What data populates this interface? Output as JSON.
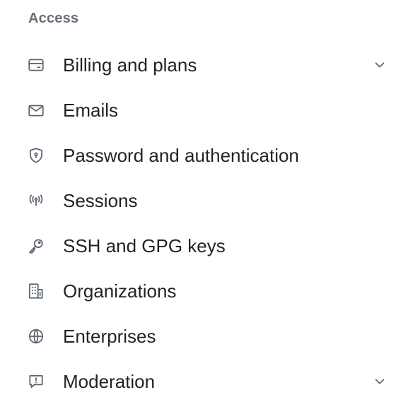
{
  "section": {
    "heading": "Access"
  },
  "nav": {
    "items": [
      {
        "label": "Billing and plans",
        "icon": "credit-card-icon",
        "expandable": true
      },
      {
        "label": "Emails",
        "icon": "mail-icon",
        "expandable": false
      },
      {
        "label": "Password and authentication",
        "icon": "shield-lock-icon",
        "expandable": false
      },
      {
        "label": "Sessions",
        "icon": "broadcast-icon",
        "expandable": false
      },
      {
        "label": "SSH and GPG keys",
        "icon": "key-icon",
        "expandable": false
      },
      {
        "label": "Organizations",
        "icon": "organization-icon",
        "expandable": false
      },
      {
        "label": "Enterprises",
        "icon": "globe-icon",
        "expandable": false
      },
      {
        "label": "Moderation",
        "icon": "report-icon",
        "expandable": true
      }
    ]
  },
  "colors": {
    "heading": "#656d76",
    "text": "#1f2328",
    "icon": "#59636e"
  }
}
